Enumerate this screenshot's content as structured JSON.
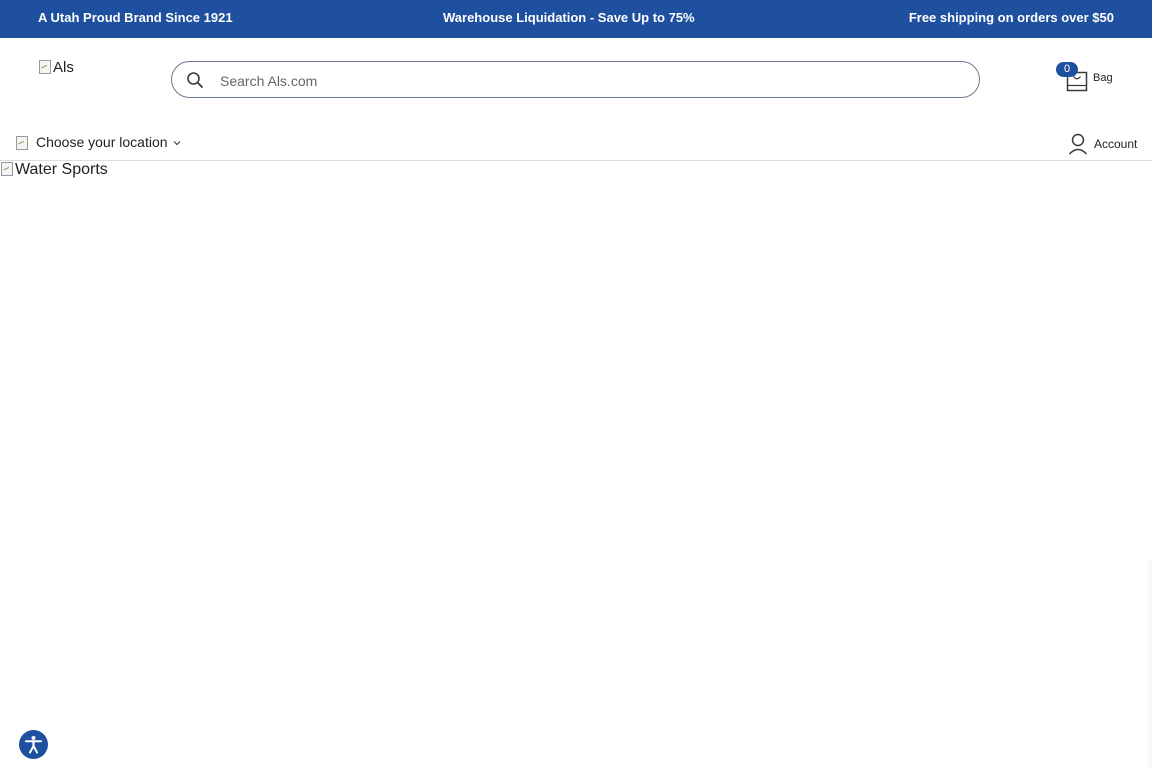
{
  "promo": {
    "left": "A Utah Proud Brand Since 1921",
    "center": "Warehouse Liquidation - Save Up to 75%",
    "right": "Free shipping on orders over $50"
  },
  "header": {
    "logo_alt": "Als",
    "search": {
      "placeholder": "Search Als.com",
      "value": "",
      "icon": "search-icon"
    },
    "bag": {
      "count": "0",
      "label": "Bag",
      "icon": "bag-icon"
    }
  },
  "subheader": {
    "location_label": "Choose your location",
    "location_icon": "chevron-down-icon",
    "account_label": "Account",
    "account_icon": "user-icon"
  },
  "hero": {
    "image_alt": "Water Sports"
  },
  "accessibility": {
    "icon": "accessibility-icon"
  },
  "colors": {
    "brand_blue": "#1f4f9f",
    "text": "#222222",
    "divider": "#dcdcdc"
  }
}
